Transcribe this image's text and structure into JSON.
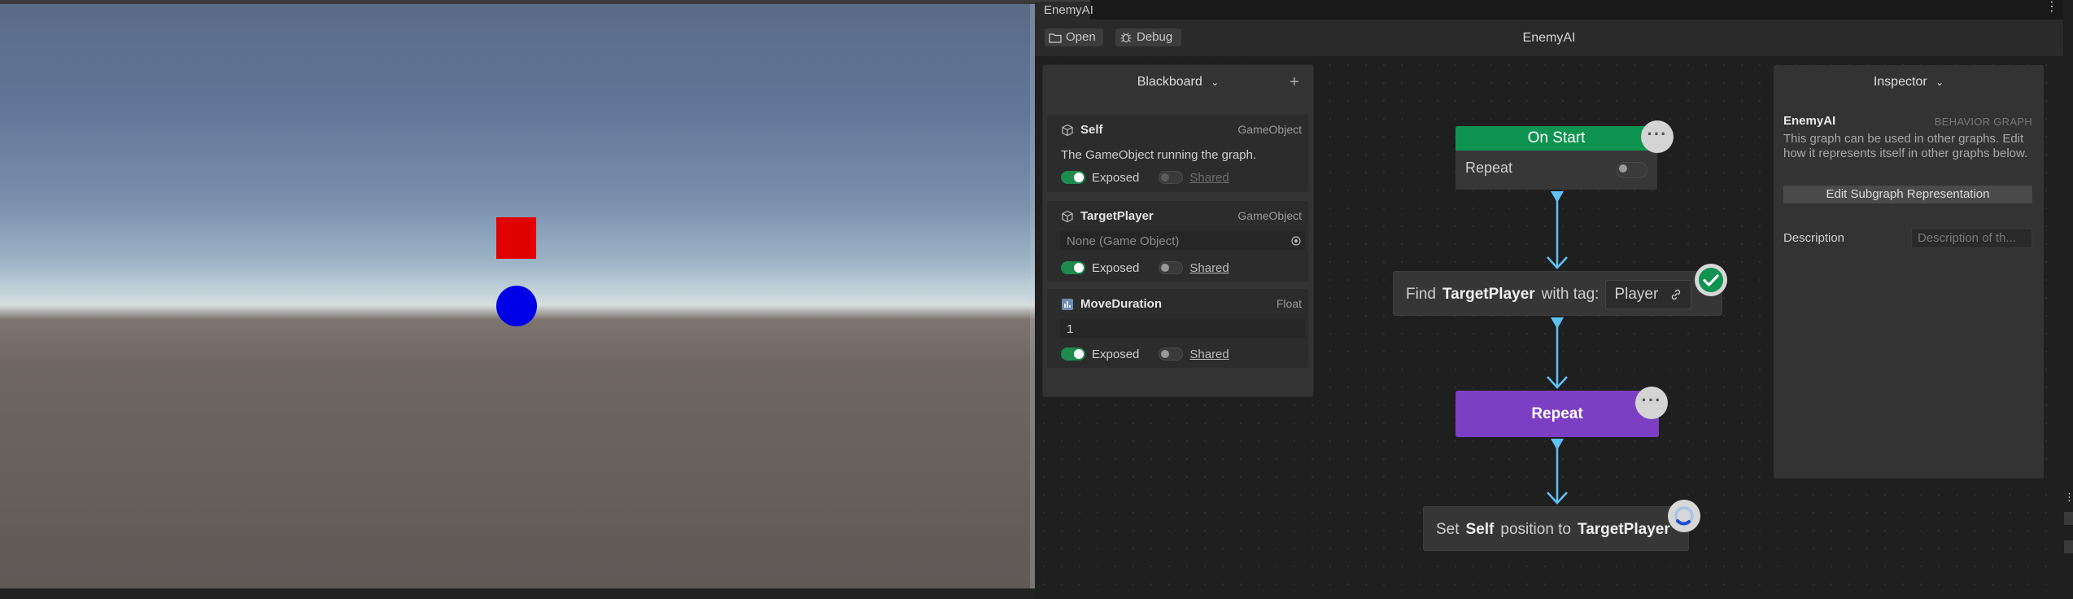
{
  "window": {
    "tab_title": "EnemyAI",
    "graph_title": "EnemyAI"
  },
  "toolbar": {
    "open_label": "Open",
    "debug_label": "Debug"
  },
  "blackboard": {
    "title": "Blackboard",
    "add_symbol": "+",
    "variables": [
      {
        "name": "Self",
        "type": "GameObject",
        "description": "The GameObject running the graph.",
        "exposed_label": "Exposed",
        "exposed": true,
        "shared_label": "Shared",
        "shared": false,
        "icon": "cube-icon"
      },
      {
        "name": "TargetPlayer",
        "type": "GameObject",
        "placeholder": "None (Game Object)",
        "exposed_label": "Exposed",
        "exposed": true,
        "shared_label": "Shared",
        "shared": false,
        "icon": "cube-icon"
      },
      {
        "name": "MoveDuration",
        "type": "Float",
        "value": "1",
        "exposed_label": "Exposed",
        "exposed": true,
        "shared_label": "Shared",
        "shared": false,
        "icon": "float-icon"
      }
    ]
  },
  "nodes": {
    "on_start": {
      "title": "On Start",
      "repeat_label": "Repeat",
      "repeat_enabled": false,
      "color": "#0f9350"
    },
    "find": {
      "prefix": "Find",
      "variable": "TargetPlayer",
      "middle": "with tag:",
      "tag_value": "Player",
      "status": "success"
    },
    "repeat": {
      "title": "Repeat",
      "color": "#7c3fc4"
    },
    "set_position": {
      "prefix": "Set",
      "target": "Self",
      "middle": "position to",
      "destination": "TargetPlayer",
      "status": "running"
    }
  },
  "inspector": {
    "title": "Inspector",
    "graph_name": "EnemyAI",
    "graph_type": "BEHAVIOR GRAPH",
    "description": "This graph can be used in other graphs. Edit how it represents itself in other graphs below.",
    "edit_button": "Edit Subgraph Representation",
    "description_label": "Description",
    "description_placeholder": "Description of th..."
  },
  "colors": {
    "connection": "#5ec2f7",
    "toggle_on": "#1e8a4d",
    "red_object": "#e00000",
    "blue_object": "#0000e6"
  }
}
